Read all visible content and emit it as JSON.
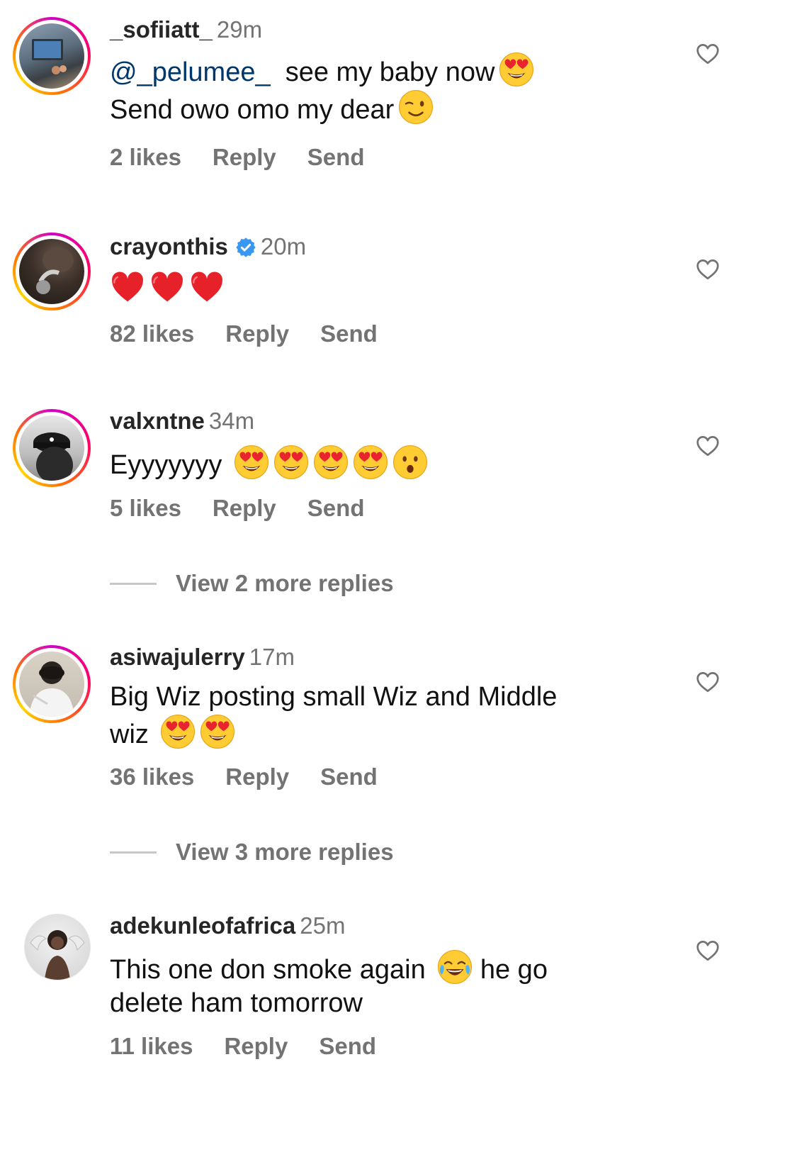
{
  "comments": [
    {
      "username": "_sofiiatt_",
      "time": "29m",
      "mention": "@_pelumee_",
      "text_line1": "see my baby now",
      "text_line2": "Send owo omo my dear",
      "likes": "2 likes",
      "reply": "Reply",
      "send": "Send"
    },
    {
      "username": "crayonthis",
      "verified": true,
      "time": "20m",
      "emojis": [
        "red-heart",
        "red-heart",
        "red-heart"
      ],
      "likes": "82 likes",
      "reply": "Reply",
      "send": "Send"
    },
    {
      "username": "valxntne",
      "time": "34m",
      "text": "Eyyyyyyy",
      "emojis": [
        "heart-eyes",
        "heart-eyes",
        "heart-eyes",
        "heart-eyes",
        "surprised"
      ],
      "likes": "5 likes",
      "reply": "Reply",
      "send": "Send",
      "view_more": "View 2 more replies"
    },
    {
      "username": "asiwajulerry",
      "time": "17m",
      "text_line1": "Big Wiz posting small Wiz and Middle",
      "text_line2": "wiz",
      "likes": "36 likes",
      "reply": "Reply",
      "send": "Send",
      "view_more": "View 3 more replies"
    },
    {
      "username": "adekunleofafrica",
      "time": "25m",
      "text_line1a": "This one don smoke again",
      "text_line1b": "he go",
      "text_line2": "delete ham tomorrow",
      "likes": "11 likes",
      "reply": "Reply",
      "send": "Send"
    }
  ],
  "colors": {
    "username": "#262626",
    "meta": "#737373",
    "mention": "#00376b",
    "verified": "#3897f0",
    "story_ring": [
      "#d300c5",
      "#ff0069",
      "#ffd600"
    ]
  }
}
